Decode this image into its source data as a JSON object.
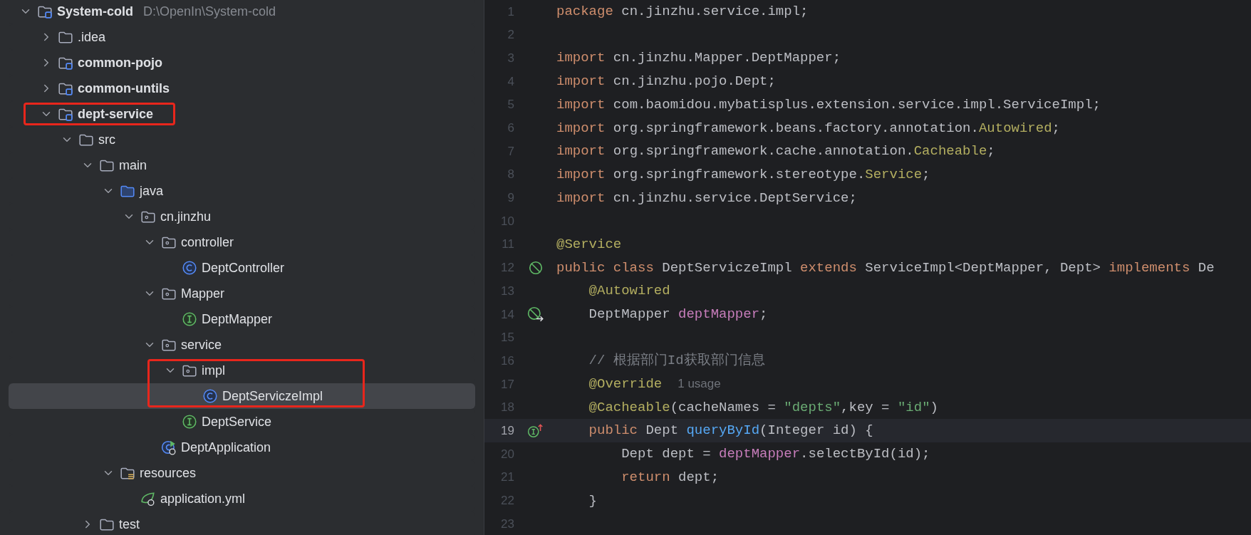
{
  "project_tree": {
    "items": [
      {
        "label": "System-cold",
        "kind": "module",
        "path": "D:\\OpenIn\\System-cold",
        "expanded": true,
        "selected": false,
        "highlighted": false,
        "children": [
          {
            "label": ".idea",
            "kind": "folder",
            "expanded": false,
            "selected": false,
            "highlighted": false
          },
          {
            "label": "common-pojo",
            "kind": "module",
            "expanded": false,
            "selected": false,
            "highlighted": false
          },
          {
            "label": "common-untils",
            "kind": "module",
            "expanded": false,
            "selected": false,
            "highlighted": false
          },
          {
            "label": "dept-service",
            "kind": "module",
            "expanded": true,
            "selected": false,
            "highlighted": true,
            "children": [
              {
                "label": "src",
                "kind": "folder",
                "expanded": true,
                "selected": false,
                "highlighted": false,
                "children": [
                  {
                    "label": "main",
                    "kind": "folder",
                    "expanded": true,
                    "selected": false,
                    "highlighted": false,
                    "children": [
                      {
                        "label": "java",
                        "kind": "source",
                        "expanded": true,
                        "selected": false,
                        "highlighted": false,
                        "children": [
                          {
                            "label": "cn.jinzhu",
                            "kind": "package",
                            "expanded": true,
                            "selected": false,
                            "highlighted": false,
                            "children": [
                              {
                                "label": "controller",
                                "kind": "package",
                                "expanded": true,
                                "selected": false,
                                "highlighted": false,
                                "children": [
                                  {
                                    "label": "DeptController",
                                    "kind": "class",
                                    "selected": false,
                                    "highlighted": false
                                  }
                                ]
                              },
                              {
                                "label": "Mapper",
                                "kind": "package",
                                "expanded": true,
                                "selected": false,
                                "highlighted": false,
                                "children": [
                                  {
                                    "label": "DeptMapper",
                                    "kind": "interface",
                                    "selected": false,
                                    "highlighted": false
                                  }
                                ]
                              },
                              {
                                "label": "service",
                                "kind": "package",
                                "expanded": true,
                                "selected": false,
                                "highlighted": false,
                                "children": [
                                  {
                                    "label": "impl",
                                    "kind": "package",
                                    "expanded": true,
                                    "selected": false,
                                    "highlighted": true,
                                    "children": [
                                      {
                                        "label": "DeptServiczeImpl",
                                        "kind": "class",
                                        "selected": true,
                                        "highlighted": true
                                      }
                                    ]
                                  },
                                  {
                                    "label": "DeptService",
                                    "kind": "interface",
                                    "selected": false,
                                    "highlighted": false
                                  }
                                ]
                              },
                              {
                                "label": "DeptApplication",
                                "kind": "app",
                                "selected": false,
                                "highlighted": false
                              }
                            ]
                          }
                        ]
                      },
                      {
                        "label": "resources",
                        "kind": "resources",
                        "expanded": true,
                        "selected": false,
                        "highlighted": false,
                        "children": [
                          {
                            "label": "application.yml",
                            "kind": "yml",
                            "selected": false,
                            "highlighted": false
                          }
                        ]
                      }
                    ]
                  },
                  {
                    "label": "test",
                    "kind": "folder",
                    "expanded": false,
                    "selected": false,
                    "highlighted": false
                  }
                ]
              }
            ]
          }
        ]
      }
    ]
  },
  "editor": {
    "lines": [
      {
        "number": "1",
        "current": false,
        "tokens": [
          {
            "kind": "kw",
            "text": "package"
          },
          {
            "kind": "plain",
            "text": " cn.jinzhu.service.impl;"
          }
        ]
      },
      {
        "number": "2",
        "current": false
      },
      {
        "number": "3",
        "current": false,
        "tokens": [
          {
            "kind": "kw",
            "text": "import"
          },
          {
            "kind": "plain",
            "text": " cn.jinzhu.Mapper.DeptMapper;"
          }
        ]
      },
      {
        "number": "4",
        "current": false,
        "tokens": [
          {
            "kind": "kw",
            "text": "import"
          },
          {
            "kind": "plain",
            "text": " cn.jinzhu.pojo.Dept;"
          }
        ]
      },
      {
        "number": "5",
        "current": false,
        "tokens": [
          {
            "kind": "kw",
            "text": "import"
          },
          {
            "kind": "plain",
            "text": " com.baomidou.mybatisplus.extension.service.impl.ServiceImpl;"
          }
        ]
      },
      {
        "number": "6",
        "current": false,
        "tokens": [
          {
            "kind": "kw",
            "text": "import"
          },
          {
            "kind": "plain",
            "text": " org.springframework.beans.factory.annotation."
          },
          {
            "kind": "ann",
            "text": "Autowired"
          },
          {
            "kind": "plain",
            "text": ";"
          }
        ]
      },
      {
        "number": "7",
        "current": false,
        "tokens": [
          {
            "kind": "kw",
            "text": "import"
          },
          {
            "kind": "plain",
            "text": " org.springframework.cache.annotation."
          },
          {
            "kind": "ann",
            "text": "Cacheable"
          },
          {
            "kind": "plain",
            "text": ";"
          }
        ]
      },
      {
        "number": "8",
        "current": false,
        "tokens": [
          {
            "kind": "kw",
            "text": "import"
          },
          {
            "kind": "plain",
            "text": " org.springframework.stereotype."
          },
          {
            "kind": "ann",
            "text": "Service"
          },
          {
            "kind": "plain",
            "text": ";"
          }
        ]
      },
      {
        "number": "9",
        "current": false,
        "tokens": [
          {
            "kind": "kw",
            "text": "import"
          },
          {
            "kind": "plain",
            "text": " cn.jinzhu.service.DeptService;"
          }
        ]
      },
      {
        "number": "10",
        "current": false
      },
      {
        "number": "11",
        "current": false,
        "tokens": [
          {
            "kind": "ann",
            "text": "@Service"
          }
        ]
      },
      {
        "number": "12",
        "current": false,
        "kind": "bean",
        "tokens": [
          {
            "kind": "kw",
            "text": "public class"
          },
          {
            "kind": "plain",
            "text": " DeptServiczeImpl "
          },
          {
            "kind": "kw",
            "text": "extends"
          },
          {
            "kind": "plain",
            "text": " ServiceImpl<DeptMapper, Dept> "
          },
          {
            "kind": "kw",
            "text": "implements"
          },
          {
            "kind": "plain",
            "text": " De"
          }
        ]
      },
      {
        "number": "13",
        "current": false,
        "tokens": [
          {
            "kind": "ann",
            "text": "    @Autowired"
          }
        ]
      },
      {
        "number": "14",
        "current": false,
        "kind": "injected",
        "tokens": [
          {
            "kind": "plain",
            "text": "    DeptMapper "
          },
          {
            "kind": "field",
            "text": "deptMapper"
          },
          {
            "kind": "plain",
            "text": ";"
          }
        ]
      },
      {
        "number": "15",
        "current": false
      },
      {
        "number": "16",
        "current": false,
        "tokens": [
          {
            "kind": "comment",
            "text": "    // 根据部门Id获取部门信息"
          }
        ]
      },
      {
        "number": "17",
        "current": false,
        "tokens": [
          {
            "kind": "ann",
            "text": "    @Override"
          },
          {
            "kind": "hint",
            "text": "1 usage"
          }
        ]
      },
      {
        "number": "18",
        "current": false,
        "tokens": [
          {
            "kind": "ann",
            "text": "    @Cacheable"
          },
          {
            "kind": "plain",
            "text": "(cacheNames = "
          },
          {
            "kind": "str",
            "text": "\"depts\""
          },
          {
            "kind": "plain",
            "text": ",key = "
          },
          {
            "kind": "str",
            "text": "\"id\""
          },
          {
            "kind": "plain",
            "text": ")"
          }
        ]
      },
      {
        "number": "19",
        "current": true,
        "kind": "implements",
        "tokens": [
          {
            "kind": "kw",
            "text": "    public"
          },
          {
            "kind": "plain",
            "text": " Dept "
          },
          {
            "kind": "method",
            "text": "queryById"
          },
          {
            "kind": "plain",
            "text": "(Integer id) {"
          }
        ]
      },
      {
        "number": "20",
        "current": false,
        "tokens": [
          {
            "kind": "plain",
            "text": "        Dept dept = "
          },
          {
            "kind": "field",
            "text": "deptMapper"
          },
          {
            "kind": "plain",
            "text": ".selectById(id);"
          }
        ]
      },
      {
        "number": "21",
        "current": false,
        "tokens": [
          {
            "kind": "kw",
            "text": "        return"
          },
          {
            "kind": "plain",
            "text": " dept;"
          }
        ]
      },
      {
        "number": "22",
        "current": false,
        "tokens": [
          {
            "kind": "plain",
            "text": "    }"
          }
        ]
      },
      {
        "number": "23",
        "current": false
      }
    ]
  }
}
